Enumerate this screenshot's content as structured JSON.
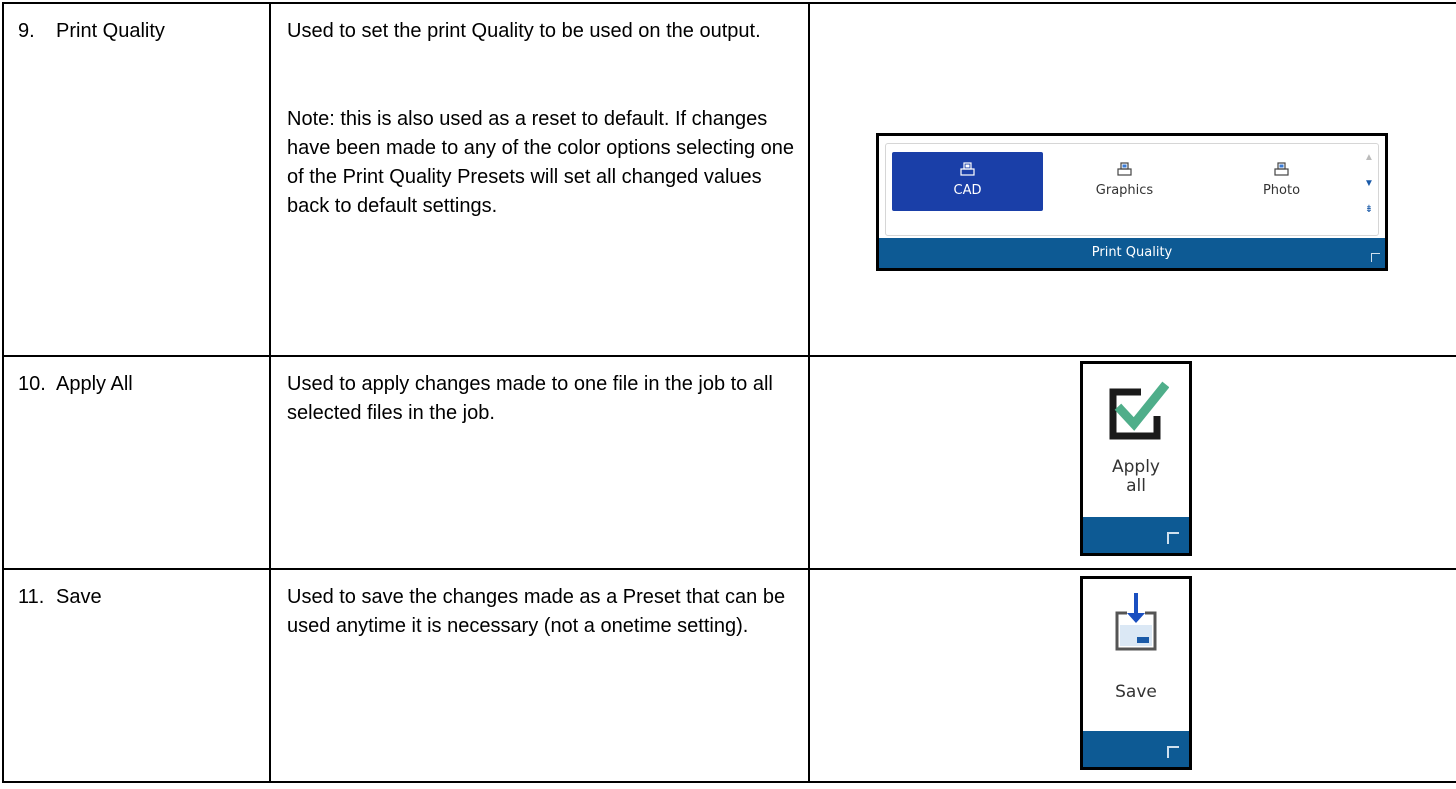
{
  "rows": [
    {
      "number": "9.",
      "feature": "Print Quality",
      "description": "Used to set the print Quality to be used on the output.",
      "note": "Note: this is also used as a reset to default. If changes have been made to any of the color options selecting one of the Print Quality Presets will set all changed values back to default settings.",
      "ribbon": {
        "presets": [
          "CAD",
          "Graphics",
          "Photo"
        ],
        "selected": "CAD",
        "group_label": "Print Quality"
      }
    },
    {
      "number": "10.",
      "feature": "Apply All",
      "description": "Used to apply changes made to one file in the job to all selected files in the job.",
      "button": {
        "label_line1": "Apply",
        "label_line2": "all",
        "icon": "checkmark-icon"
      }
    },
    {
      "number": "11.",
      "feature": "Save",
      "description": "Used to save the changes made as a Preset that can be used anytime it is necessary (not a onetime setting).",
      "button": {
        "label": "Save",
        "icon": "save-icon"
      }
    }
  ],
  "colors": {
    "ribbon_blue": "#0d5a94",
    "selected_blue": "#1a3fa8",
    "check_green": "#4fae8a"
  }
}
